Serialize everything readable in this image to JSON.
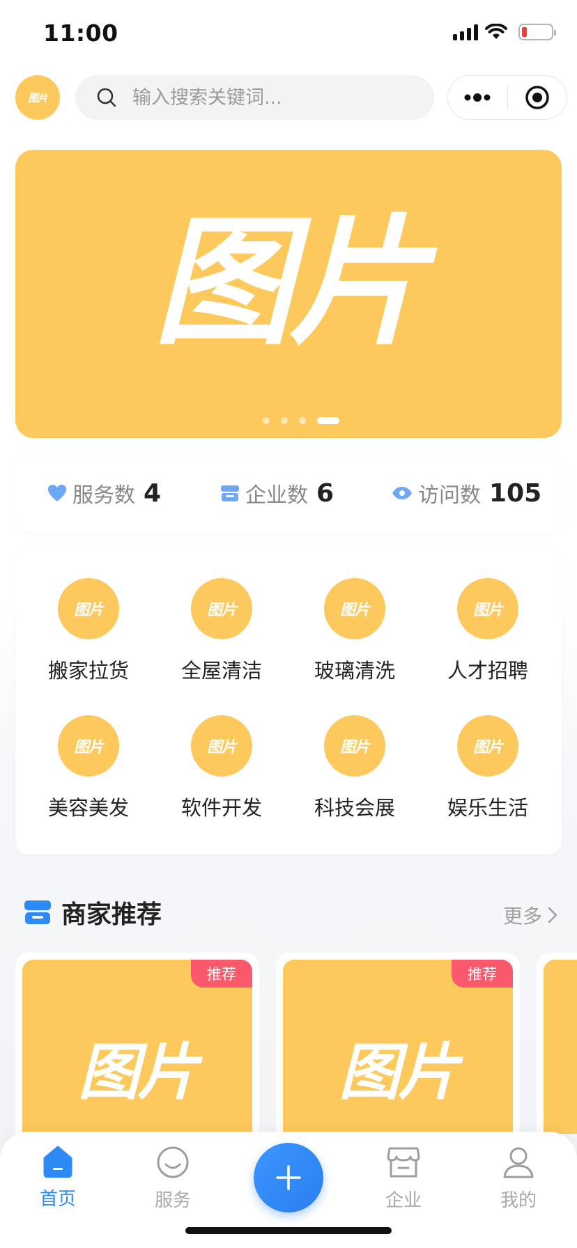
{
  "status_bar": {
    "time": "11:00"
  },
  "top_bar": {
    "logo_text": "图片",
    "search_placeholder": "输入搜索关键词...",
    "menu_icon": "more-dots-icon",
    "close_icon": "target-circle-icon"
  },
  "banner": {
    "image_text": "图片",
    "slide_count": 4,
    "active_slide": 4
  },
  "stats": [
    {
      "label": "服务数",
      "value": "4",
      "icon": "heart-icon"
    },
    {
      "label": "企业数",
      "value": "6",
      "icon": "store-icon"
    },
    {
      "label": "访问数",
      "value": "105",
      "icon": "eye-icon"
    }
  ],
  "categories": [
    {
      "label": "搬家拉货",
      "icon_text": "图片"
    },
    {
      "label": "全屋清洁",
      "icon_text": "图片"
    },
    {
      "label": "玻璃清洗",
      "icon_text": "图片"
    },
    {
      "label": "人才招聘",
      "icon_text": "图片"
    },
    {
      "label": "美容美发",
      "icon_text": "图片"
    },
    {
      "label": "软件开发",
      "icon_text": "图片"
    },
    {
      "label": "科技会展",
      "icon_text": "图片"
    },
    {
      "label": "娱乐生活",
      "icon_text": "图片"
    }
  ],
  "merchant_section": {
    "title": "商家推荐",
    "more_label": "更多",
    "cards": [
      {
        "image_text": "图片",
        "tag": "推荐"
      },
      {
        "image_text": "图片",
        "tag": "推荐"
      }
    ]
  },
  "tab_bar": {
    "tabs": [
      {
        "label": "首页",
        "icon": "home-icon",
        "active": true
      },
      {
        "label": "服务",
        "icon": "smile-icon",
        "active": false
      },
      {
        "label": "企业",
        "icon": "store-icon",
        "active": false
      },
      {
        "label": "我的",
        "icon": "user-icon",
        "active": false
      }
    ],
    "center_button_icon": "plus-icon"
  },
  "colors": {
    "accent": "#2d8af5",
    "placeholder_image": "#fdc95d",
    "tag": "#f9596a",
    "text_muted": "#a9a9a9"
  }
}
